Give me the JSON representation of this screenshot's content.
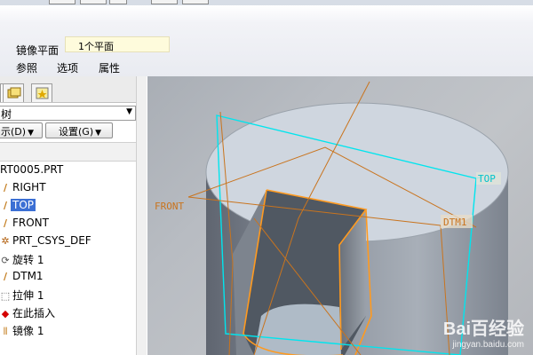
{
  "dashboard": {
    "mirror_plane_label": "镜像平面",
    "mirror_plane_value": "1个平面",
    "tabs": [
      {
        "label": "参照"
      },
      {
        "label": "选项"
      },
      {
        "label": "属性"
      }
    ]
  },
  "tree": {
    "select_value": "树",
    "buttons": [
      {
        "label": "示(D)"
      },
      {
        "label": "设置(G)"
      }
    ],
    "items": [
      {
        "label": "RT0005.PRT",
        "icon": "part-icon"
      },
      {
        "label": "RIGHT",
        "icon": "datum-plane-icon"
      },
      {
        "label": "TOP",
        "icon": "datum-plane-icon",
        "selected": true
      },
      {
        "label": "FRONT",
        "icon": "datum-plane-icon"
      },
      {
        "label": "PRT_CSYS_DEF",
        "icon": "csys-icon"
      },
      {
        "label": "旋转 1",
        "icon": "revolve-icon"
      },
      {
        "label": "DTM1",
        "icon": "datum-plane-icon"
      },
      {
        "label": "拉伸 1",
        "icon": "extrude-icon"
      },
      {
        "label": "在此插入",
        "icon": "insert-here-icon"
      },
      {
        "label": "镜像 1",
        "icon": "mirror-icon"
      }
    ]
  },
  "viewport": {
    "datum_labels": {
      "top": "TOP",
      "front": "FRONT",
      "dtm1": "DTM1"
    },
    "colors": {
      "highlight": "#00e5ee",
      "datum": "#c9741e",
      "cylinder_top": "#cfd6df",
      "selection": "#ff9a1f"
    }
  },
  "watermark": {
    "logo": "Bai百经验",
    "url": "jingyan.baidu.com"
  }
}
